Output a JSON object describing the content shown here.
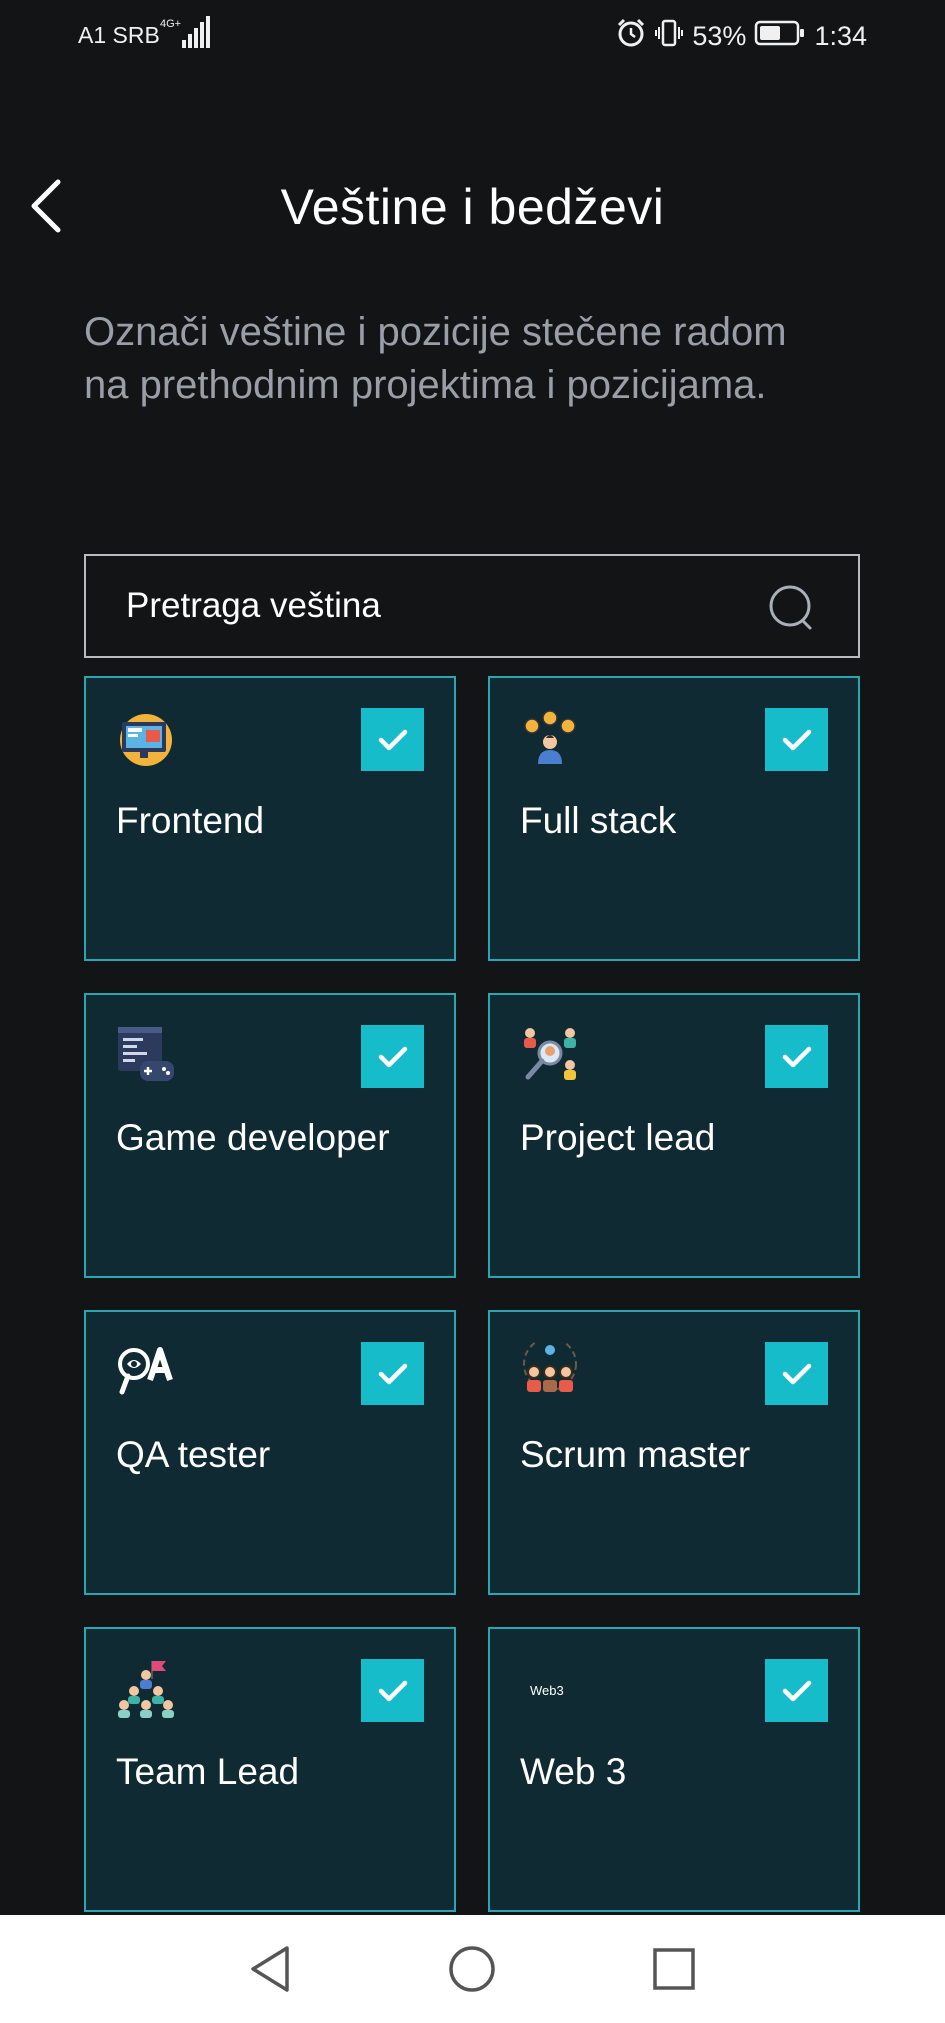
{
  "status_bar": {
    "carrier": "A1 SRB",
    "network": "4G+",
    "battery_percent": "53%",
    "time": "1:34"
  },
  "header": {
    "title": "Veštine i bedževi"
  },
  "subtitle": "Označi veštine i pozicije stečene radom na prethodnim projektima i pozicijama.",
  "search": {
    "value": "Pretraga veština"
  },
  "skills": [
    {
      "label": "Frontend",
      "icon": "frontend-monitor-icon",
      "checked": true
    },
    {
      "label": "Full stack",
      "icon": "full-stack-developer-icon",
      "checked": true
    },
    {
      "label": "Game developer",
      "icon": "game-code-gamepad-icon",
      "checked": true
    },
    {
      "label": "Project lead",
      "icon": "project-lead-team-icon",
      "checked": true
    },
    {
      "label": "QA tester",
      "icon": "qa-magnifier-icon",
      "checked": true
    },
    {
      "label": "Scrum master",
      "icon": "scrum-team-icon",
      "checked": true
    },
    {
      "label": "Team Lead",
      "icon": "team-lead-flag-icon",
      "checked": true
    },
    {
      "label": "Web 3",
      "icon": "web3-logo-icon",
      "icon_text": "Web3",
      "checked": true
    }
  ],
  "colors": {
    "background": "#121416",
    "card_background": "#0f2a32",
    "card_border": "#2aa6b3",
    "check_background": "#17bccb",
    "subtitle_text": "#9a9ea6"
  }
}
